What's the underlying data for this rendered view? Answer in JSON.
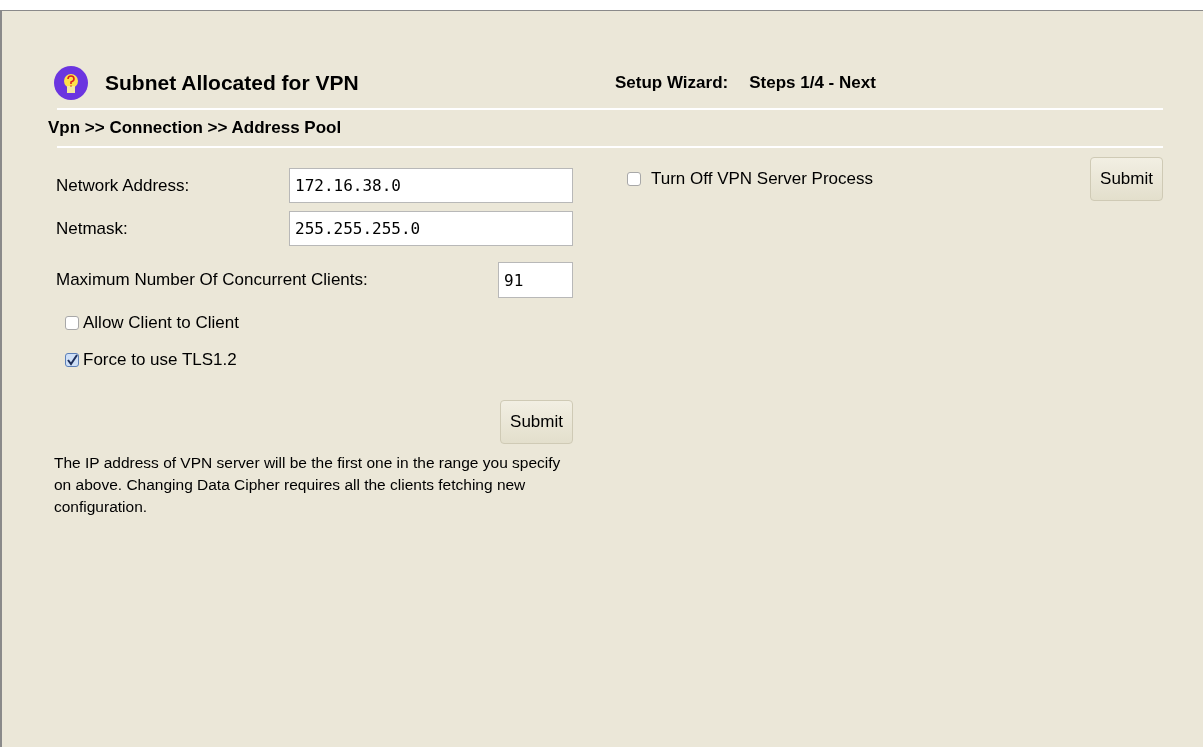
{
  "header": {
    "title": "Subnet Allocated for VPN",
    "wizard_label": "Setup Wizard:",
    "wizard_steps": "Steps 1/4 - Next"
  },
  "breadcrumb": "Vpn >> Connection >> Address Pool",
  "fields": [
    {
      "label": "Network Address:",
      "value": "172.16.38.0",
      "kind": "wide"
    },
    {
      "label": "Netmask:",
      "value": "255.255.255.0",
      "kind": "wide"
    },
    {
      "label": "Maximum Number Of Concurrent Clients:",
      "value": "91",
      "kind": "narrow"
    }
  ],
  "options": [
    {
      "label": "Allow Client to Client",
      "checked": false
    },
    {
      "label": "Force to use TLS1.2",
      "checked": true
    }
  ],
  "submit_left": "Submit",
  "note": "The IP address of VPN server will be the first one in the range you specify on above. Changing Data Cipher requires all the clients fetching new configuration.",
  "server_option": {
    "label": "Turn Off VPN Server Process",
    "checked": false
  },
  "submit_right": "Submit"
}
